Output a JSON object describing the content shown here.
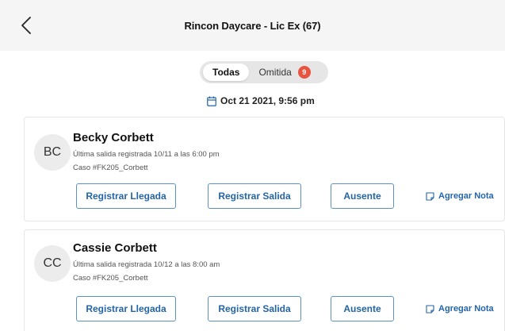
{
  "header": {
    "title": "Rincon Daycare - Lic Ex (67)"
  },
  "filter": {
    "tabs": [
      {
        "label": "Todas"
      },
      {
        "label": "Omitida",
        "badge": "9"
      }
    ]
  },
  "date": {
    "text": "Oct 21 2021, 9:56 pm"
  },
  "children": [
    {
      "initials": "BC",
      "name": "Becky Corbett",
      "last_checkout": "Última salida registrada 10/11 a las 6:00 pm",
      "case": "Caso  #FK205_Corbett"
    },
    {
      "initials": "CC",
      "name": "Cassie Corbett",
      "last_checkout": "Última salida registrada 10/12 a las 8:00 am",
      "case": "Caso  #FK205_Corbett"
    }
  ],
  "actions": {
    "check_in": "Registrar Llegada",
    "check_out": "Registrar Salida",
    "absent": "Ausente",
    "add_note": "Agregar Nota"
  },
  "colors": {
    "accent": "#2464a8",
    "badge": "#e8543f",
    "header_bg": "#f5f5f5"
  }
}
